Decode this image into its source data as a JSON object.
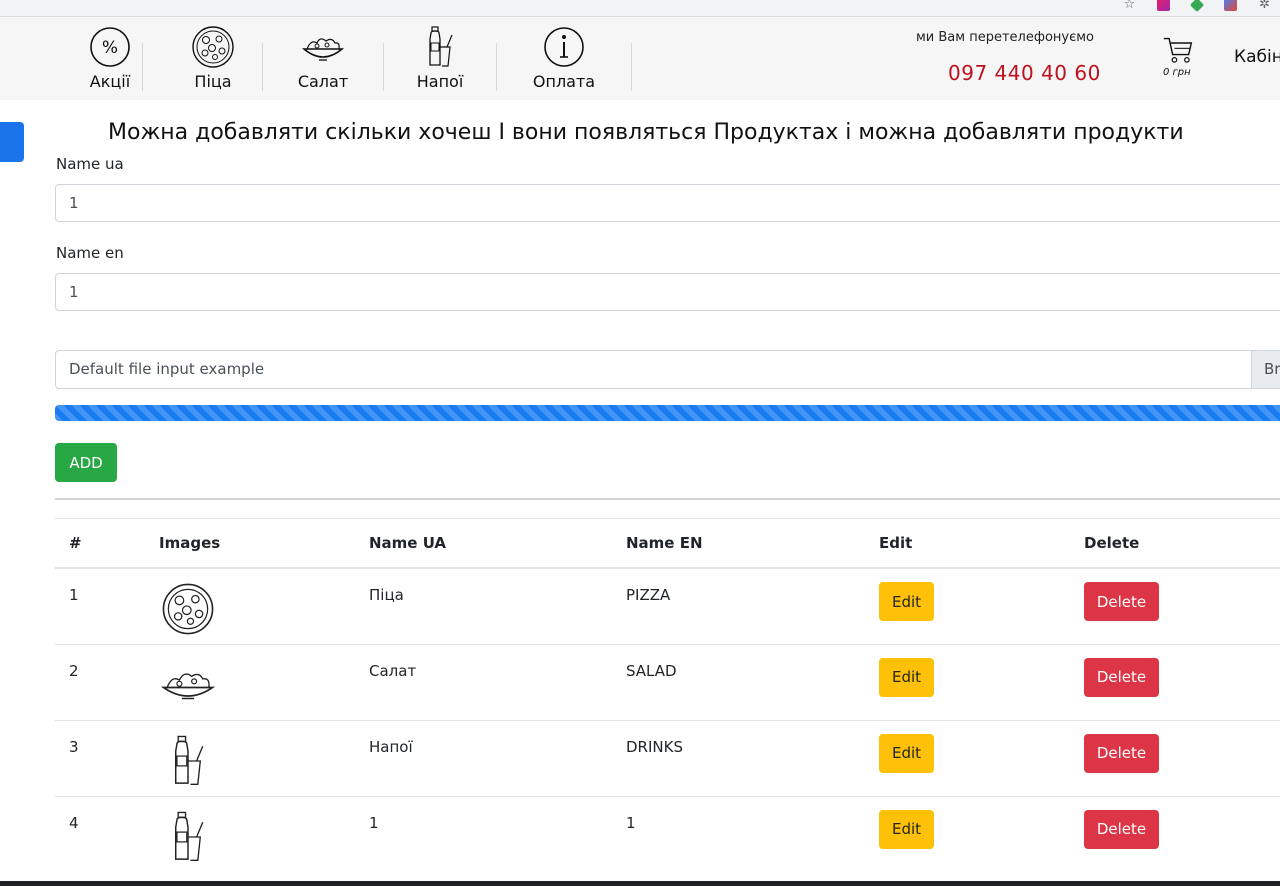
{
  "browser": {
    "icons": [
      "star-icon",
      "extension-pink-icon",
      "extension-green-icon",
      "extension-multi-icon",
      "puzzle-icon"
    ]
  },
  "header": {
    "nav": [
      {
        "label": "Акції",
        "icon": "percent-icon"
      },
      {
        "label": "Піца",
        "icon": "pizza-icon"
      },
      {
        "label": "Салат",
        "icon": "salad-icon"
      },
      {
        "label": "Напої",
        "icon": "drink-icon"
      },
      {
        "label": "Оплата",
        "icon": "info-icon"
      }
    ],
    "callback_text": "ми Вам перетелефонуємо",
    "phone": "097 440 40 60",
    "cart_sum": "0 грн",
    "cabinet": "Кабін"
  },
  "main": {
    "heading": "Можна добавляти скільки хочеш І вони появляться Продуктах і можна добавляти продукти",
    "name_ua_label": "Name ua",
    "name_ua_value": "1",
    "name_en_label": "Name en",
    "name_en_value": "1",
    "file_placeholder": "Default file input example",
    "file_browse": "Browse",
    "progress_percent": 100,
    "add_label": "ADD"
  },
  "table": {
    "headers": [
      "#",
      "Images",
      "Name UA",
      "Name EN",
      "Edit",
      "Delete"
    ],
    "rows": [
      {
        "num": "1",
        "image": "pizza-icon",
        "name_ua": "Піца",
        "name_en": "PIZZA",
        "edit": "Edit",
        "delete": "Delete"
      },
      {
        "num": "2",
        "image": "salad-icon",
        "name_ua": "Салат",
        "name_en": "SALAD",
        "edit": "Edit",
        "delete": "Delete"
      },
      {
        "num": "3",
        "image": "drink-icon",
        "name_ua": "Напої",
        "name_en": "DRINKS",
        "edit": "Edit",
        "delete": "Delete"
      },
      {
        "num": "4",
        "image": "drink-icon",
        "name_ua": "1",
        "name_en": "1",
        "edit": "Edit",
        "delete": "Delete"
      }
    ]
  },
  "colors": {
    "phone": "#c0101e",
    "add_button": "#28a745",
    "edit_button": "#ffc107",
    "delete_button": "#dc3545",
    "progress": "#1a7cf2",
    "side_tab": "#1a73e8"
  }
}
